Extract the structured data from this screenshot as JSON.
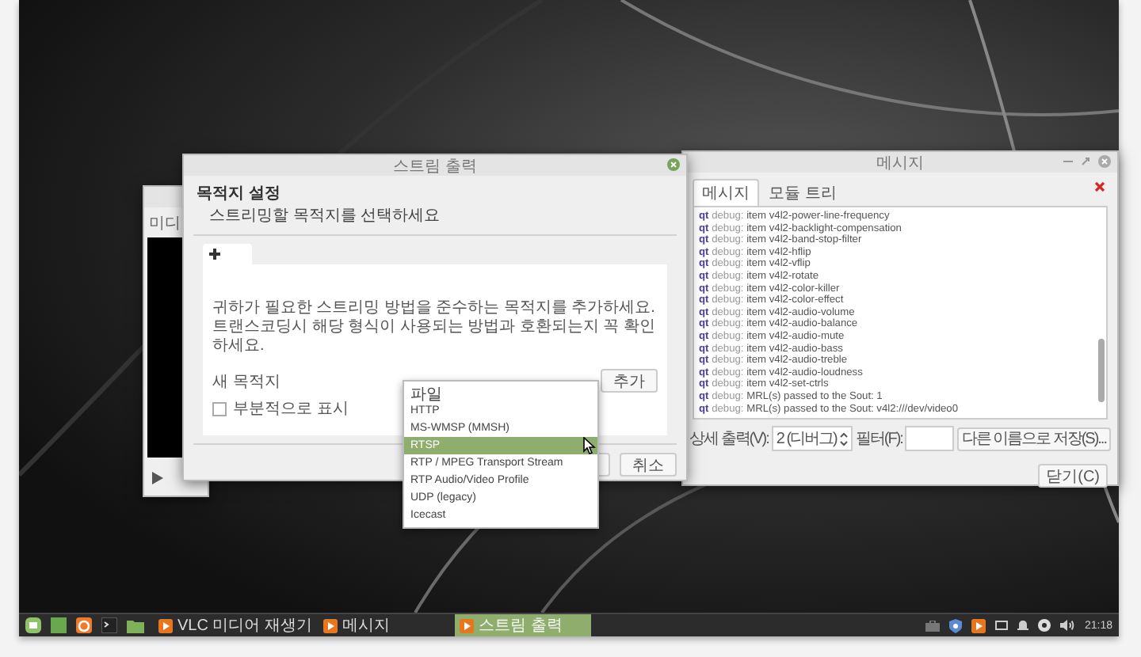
{
  "media_player_window": {
    "title": "미디"
  },
  "stream_output_dialog": {
    "title": "스트림 출력",
    "heading": "목적지 설정",
    "subheading": "스트리밍할 목적지를 선택하세요",
    "description": "귀하가 필요한 스트리밍 방법을 준수하는 목적지를 추가하세요. 트랜스코딩시 해당 형식이 사용되는 방법과 호환되는지 꼭 확인하세요.",
    "new_destination_label": "새 목적지",
    "add_button": "추가",
    "partial_checkbox": {
      "label": "부분적으로 표시",
      "checked": false
    },
    "cancel_button": "취소"
  },
  "destination_dropdown": {
    "options": [
      {
        "label": "파일",
        "selected": false
      },
      {
        "label": "HTTP",
        "selected": false
      },
      {
        "label": "MS-WMSP (MMSH)",
        "selected": false
      },
      {
        "label": "RTSP",
        "selected": true
      },
      {
        "label": "RTP / MPEG Transport Stream",
        "selected": false
      },
      {
        "label": "RTP Audio/Video Profile",
        "selected": false
      },
      {
        "label": "UDP (legacy)",
        "selected": false
      },
      {
        "label": "Icecast",
        "selected": false
      }
    ]
  },
  "messages_window": {
    "title": "메시지",
    "tabs": [
      {
        "label": "메시지",
        "selected": true
      },
      {
        "label": "모듈 트리",
        "selected": false
      }
    ],
    "log": [
      {
        "source": "qt",
        "level": "debug:",
        "text": "item v4l2-power-line-frequency"
      },
      {
        "source": "qt",
        "level": "debug:",
        "text": "item v4l2-backlight-compensation"
      },
      {
        "source": "qt",
        "level": "debug:",
        "text": "item v4l2-band-stop-filter"
      },
      {
        "source": "qt",
        "level": "debug:",
        "text": "item v4l2-hflip"
      },
      {
        "source": "qt",
        "level": "debug:",
        "text": "item v4l2-vflip"
      },
      {
        "source": "qt",
        "level": "debug:",
        "text": "item v4l2-rotate"
      },
      {
        "source": "qt",
        "level": "debug:",
        "text": "item v4l2-color-killer"
      },
      {
        "source": "qt",
        "level": "debug:",
        "text": "item v4l2-color-effect"
      },
      {
        "source": "qt",
        "level": "debug:",
        "text": "item v4l2-audio-volume"
      },
      {
        "source": "qt",
        "level": "debug:",
        "text": "item v4l2-audio-balance"
      },
      {
        "source": "qt",
        "level": "debug:",
        "text": "item v4l2-audio-mute"
      },
      {
        "source": "qt",
        "level": "debug:",
        "text": "item v4l2-audio-bass"
      },
      {
        "source": "qt",
        "level": "debug:",
        "text": "item v4l2-audio-treble"
      },
      {
        "source": "qt",
        "level": "debug:",
        "text": "item v4l2-audio-loudness"
      },
      {
        "source": "qt",
        "level": "debug:",
        "text": "item v4l2-set-ctrls"
      },
      {
        "source": "qt",
        "level": "debug:",
        "text": "MRL(s) passed to the Sout: 1"
      },
      {
        "source": "qt",
        "level": "debug:",
        "text": "MRL(s) passed to the Sout: v4l2:///dev/video0"
      }
    ],
    "verbosity_label": "상세 출력(V):",
    "verbosity_value": "2 (디버그)",
    "filter_label": "필터(F):",
    "save_button": "다른 이름으로 저장(S)...",
    "close_button": "닫기(C)"
  },
  "taskbar": {
    "tasks": [
      {
        "label": "VLC 미디어 재생기",
        "selected": false
      },
      {
        "label": "메시지",
        "selected": false
      },
      {
        "label": "스트림 출력",
        "selected": true
      }
    ],
    "clock": "21:18"
  }
}
